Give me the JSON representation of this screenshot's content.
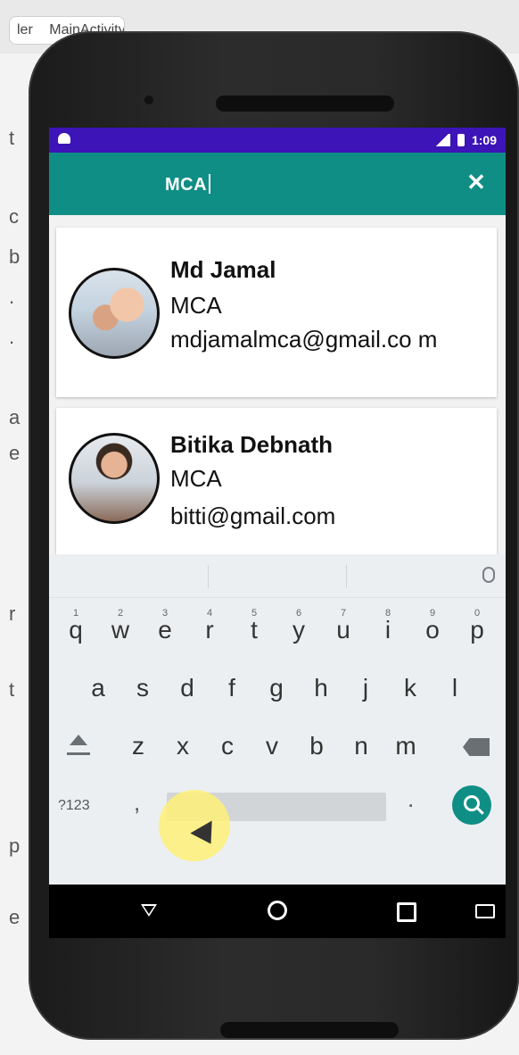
{
  "background": {
    "tab_label": "ler",
    "tab_title": "MainActivity",
    "left_fragments": [
      "t",
      "c",
      "b",
      ".",
      ".",
      "a",
      "e",
      "r",
      "t",
      "p",
      "e"
    ]
  },
  "app": {
    "status_time": "1:09",
    "search_query": "MCA",
    "theme_colors": {
      "status_bar": "#3d14b8",
      "app_bar": "#0f8e86",
      "accent": "#0f8e86"
    }
  },
  "results": [
    {
      "name": "Md Jamal",
      "course": "MCA",
      "email": "mdjamalmca@gmail.co m"
    },
    {
      "name": "Bitika Debnath",
      "course": "MCA",
      "email": "bitti@gmail.com"
    }
  ],
  "keyboard": {
    "row1": [
      "q",
      "w",
      "e",
      "r",
      "t",
      "y",
      "u",
      "i",
      "o",
      "p"
    ],
    "row1_hints": [
      "1",
      "2",
      "3",
      "4",
      "5",
      "6",
      "7",
      "8",
      "9",
      "0"
    ],
    "row2": [
      "a",
      "s",
      "d",
      "f",
      "g",
      "h",
      "j",
      "k",
      "l"
    ],
    "row3": [
      "z",
      "x",
      "c",
      "v",
      "b",
      "n",
      "m"
    ],
    "mode_key": "?123",
    "comma": ",",
    "period": "."
  },
  "icons": {
    "close": "close-icon",
    "mic": "mic-icon",
    "shift": "shift-icon",
    "backspace": "backspace-icon",
    "search": "search-icon",
    "back": "back-icon",
    "home": "home-icon",
    "recent": "recent-apps-icon",
    "keyboard": "keyboard-icon"
  }
}
